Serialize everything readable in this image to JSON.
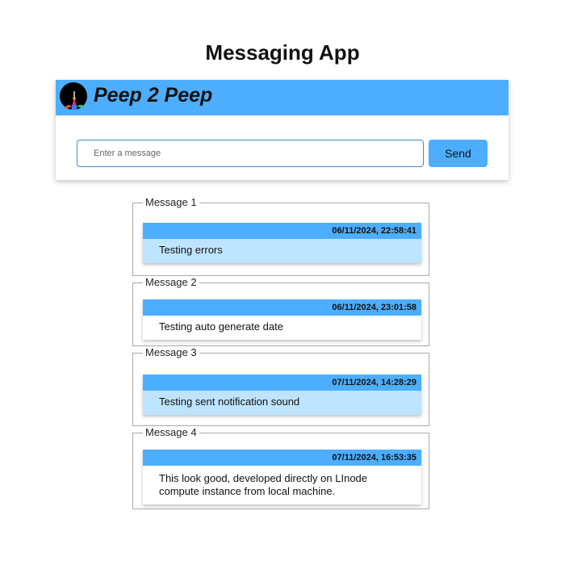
{
  "page": {
    "title": "Messaging App"
  },
  "header": {
    "brand": "Peep 2 Peep"
  },
  "composer": {
    "placeholder": "Enter a message",
    "send_label": "Send"
  },
  "colors": {
    "accent": "#4daeff",
    "highlight": "#bfe4ff",
    "border": "#a9a9a9"
  },
  "messages": [
    {
      "legend": "Message 1",
      "timestamp": "06/11/2024, 22:58:41",
      "text": "Testing errors",
      "highlighted": true
    },
    {
      "legend": "Message 2",
      "timestamp": "06/11/2024, 23:01:58",
      "text": "Testing auto generate date",
      "highlighted": false
    },
    {
      "legend": "Message 3",
      "timestamp": "07/11/2024, 14:28:29",
      "text": "Testing sent notification sound",
      "highlighted": true
    },
    {
      "legend": "Message 4",
      "timestamp": "07/11/2024, 16:53:35",
      "text": "This look good, developed directly on LInode compute instance from local machine.",
      "highlighted": false
    }
  ]
}
